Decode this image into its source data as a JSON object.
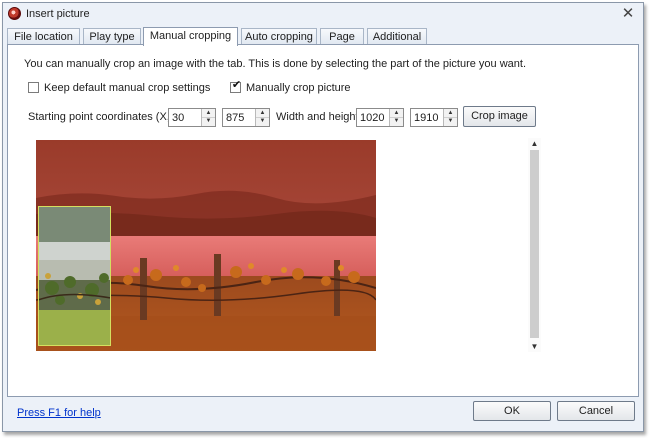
{
  "window": {
    "title": "Insert picture",
    "icon": "app-logo-icon",
    "close_glyph": "✕"
  },
  "tabs": [
    {
      "label": "File location",
      "active": false
    },
    {
      "label": "Play type",
      "active": false
    },
    {
      "label": "Manual cropping",
      "active": true
    },
    {
      "label": "Auto cropping",
      "active": false
    },
    {
      "label": "Page",
      "active": false
    },
    {
      "label": "Additional",
      "active": false
    }
  ],
  "panel": {
    "intro": "You can manually crop an image with the tab.  This is done by selecting the part of the picture you want.",
    "keep_default": {
      "label": "Keep default manual crop settings",
      "checked": false
    },
    "manual_crop": {
      "label": "Manually crop picture",
      "checked": true,
      "mark": "✔"
    },
    "start_label": "Starting point coordinates (X,Y)",
    "x_value": "30",
    "y_value": "875",
    "size_label": "Width and height",
    "width_value": "1020",
    "height_value": "1910",
    "spin_up": "▲",
    "spin_down": "▼",
    "crop_button": "Crop image",
    "scroll_up": "▲",
    "scroll_down": "▼"
  },
  "footer": {
    "help": "Press F1 for help",
    "ok": "OK",
    "cancel": "Cancel"
  },
  "colors": {
    "selection_border": "#d4e060",
    "overlay_tint": "#c0392b"
  }
}
